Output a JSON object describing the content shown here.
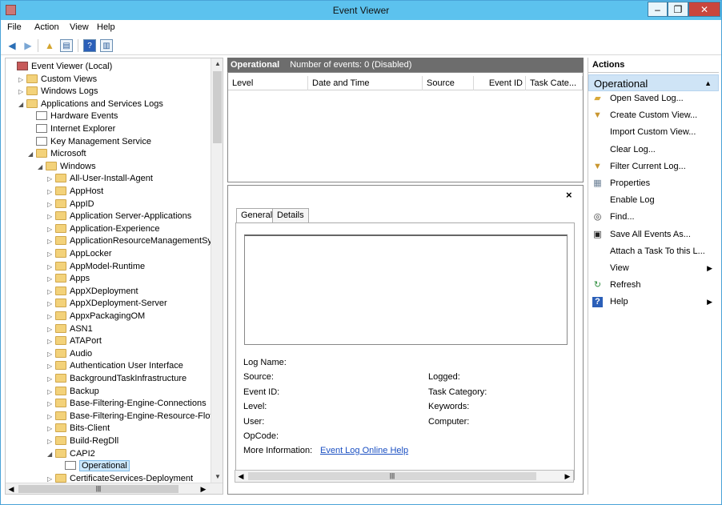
{
  "window": {
    "title": "Event Viewer",
    "controls": {
      "minimize": "–",
      "maximize": "❐",
      "close": "✕"
    }
  },
  "menu": [
    "File",
    "Action",
    "View",
    "Help"
  ],
  "tree": {
    "rows": [
      {
        "label": "Event Viewer (Local)",
        "icon": "event-viewer-icon",
        "arrow": "",
        "depth": 0
      },
      {
        "label": "Custom Views",
        "icon": "folder-icon",
        "arrow": "▷",
        "depth": 1
      },
      {
        "label": "Windows Logs",
        "icon": "folder-icon",
        "arrow": "▷",
        "depth": 1
      },
      {
        "label": "Applications and Services Logs",
        "icon": "folder-icon",
        "arrow": "◢",
        "depth": 1
      },
      {
        "label": "Hardware Events",
        "icon": "log-icon",
        "arrow": "",
        "depth": 2
      },
      {
        "label": "Internet Explorer",
        "icon": "log-icon",
        "arrow": "",
        "depth": 2
      },
      {
        "label": "Key Management Service",
        "icon": "log-icon",
        "arrow": "",
        "depth": 2
      },
      {
        "label": "Microsoft",
        "icon": "folder-icon",
        "arrow": "◢",
        "depth": 2
      },
      {
        "label": "Windows",
        "icon": "folder-icon",
        "arrow": "◢",
        "depth": 3
      },
      {
        "label": "All-User-Install-Agent",
        "icon": "folder-icon",
        "arrow": "▷",
        "depth": 4
      },
      {
        "label": "AppHost",
        "icon": "folder-icon",
        "arrow": "▷",
        "depth": 4
      },
      {
        "label": "AppID",
        "icon": "folder-icon",
        "arrow": "▷",
        "depth": 4
      },
      {
        "label": "Application Server-Applications",
        "icon": "folder-icon",
        "arrow": "▷",
        "depth": 4
      },
      {
        "label": "Application-Experience",
        "icon": "folder-icon",
        "arrow": "▷",
        "depth": 4
      },
      {
        "label": "ApplicationResourceManagementSy",
        "icon": "folder-icon",
        "arrow": "▷",
        "depth": 4
      },
      {
        "label": "AppLocker",
        "icon": "folder-icon",
        "arrow": "▷",
        "depth": 4
      },
      {
        "label": "AppModel-Runtime",
        "icon": "folder-icon",
        "arrow": "▷",
        "depth": 4
      },
      {
        "label": "Apps",
        "icon": "folder-icon",
        "arrow": "▷",
        "depth": 4
      },
      {
        "label": "AppXDeployment",
        "icon": "folder-icon",
        "arrow": "▷",
        "depth": 4
      },
      {
        "label": "AppXDeployment-Server",
        "icon": "folder-icon",
        "arrow": "▷",
        "depth": 4
      },
      {
        "label": "AppxPackagingOM",
        "icon": "folder-icon",
        "arrow": "▷",
        "depth": 4
      },
      {
        "label": "ASN1",
        "icon": "folder-icon",
        "arrow": "▷",
        "depth": 4
      },
      {
        "label": "ATAPort",
        "icon": "folder-icon",
        "arrow": "▷",
        "depth": 4
      },
      {
        "label": "Audio",
        "icon": "folder-icon",
        "arrow": "▷",
        "depth": 4
      },
      {
        "label": "Authentication User Interface",
        "icon": "folder-icon",
        "arrow": "▷",
        "depth": 4
      },
      {
        "label": "BackgroundTaskInfrastructure",
        "icon": "folder-icon",
        "arrow": "▷",
        "depth": 4
      },
      {
        "label": "Backup",
        "icon": "folder-icon",
        "arrow": "▷",
        "depth": 4
      },
      {
        "label": "Base-Filtering-Engine-Connections",
        "icon": "folder-icon",
        "arrow": "▷",
        "depth": 4
      },
      {
        "label": "Base-Filtering-Engine-Resource-Flov",
        "icon": "folder-icon",
        "arrow": "▷",
        "depth": 4
      },
      {
        "label": "Bits-Client",
        "icon": "folder-icon",
        "arrow": "▷",
        "depth": 4
      },
      {
        "label": "Build-RegDll",
        "icon": "folder-icon",
        "arrow": "▷",
        "depth": 4
      },
      {
        "label": "CAPI2",
        "icon": "folder-icon",
        "arrow": "◢",
        "depth": 4
      },
      {
        "label": "Operational",
        "icon": "log-icon",
        "arrow": "",
        "depth": 5,
        "selected": true
      },
      {
        "label": "CertificateServices-Deployment",
        "icon": "folder-icon",
        "arrow": "▷",
        "depth": 4
      }
    ]
  },
  "center": {
    "header_name": "Operational",
    "header_info": "Number of events: 0 (Disabled)",
    "columns": [
      "Level",
      "Date and Time",
      "Source",
      "Event ID",
      "Task Cate..."
    ],
    "detail": {
      "close": "×",
      "tabs": [
        "General",
        "Details"
      ],
      "fields_left": [
        "Log Name:",
        "Source:",
        "Event ID:",
        "Level:",
        "User:",
        "OpCode:",
        "More Information:"
      ],
      "fields_right": [
        "Logged:",
        "Task Category:",
        "Keywords:",
        "Computer:"
      ],
      "help_link": "Event Log Online Help"
    }
  },
  "actions": {
    "title": "Actions",
    "section": "Operational",
    "items": [
      {
        "label": "Open Saved Log...",
        "icon": "open-folder-icon",
        "submenu": false
      },
      {
        "label": "Create Custom View...",
        "icon": "filter-icon",
        "submenu": false
      },
      {
        "label": "Import Custom View...",
        "icon": "",
        "submenu": false
      },
      {
        "label": "Clear Log...",
        "icon": "",
        "submenu": false
      },
      {
        "label": "Filter Current Log...",
        "icon": "filter-icon",
        "submenu": false
      },
      {
        "label": "Properties",
        "icon": "properties-icon",
        "submenu": false
      },
      {
        "label": "Enable Log",
        "icon": "",
        "submenu": false
      },
      {
        "label": "Find...",
        "icon": "binoculars-icon",
        "submenu": false
      },
      {
        "label": "Save All Events As...",
        "icon": "save-icon",
        "submenu": false
      },
      {
        "label": "Attach a Task To this L...",
        "icon": "",
        "submenu": false
      },
      {
        "label": "View",
        "icon": "",
        "submenu": true
      },
      {
        "label": "Refresh",
        "icon": "refresh-icon",
        "submenu": false
      },
      {
        "label": "Help",
        "icon": "help-icon",
        "submenu": true
      }
    ]
  }
}
